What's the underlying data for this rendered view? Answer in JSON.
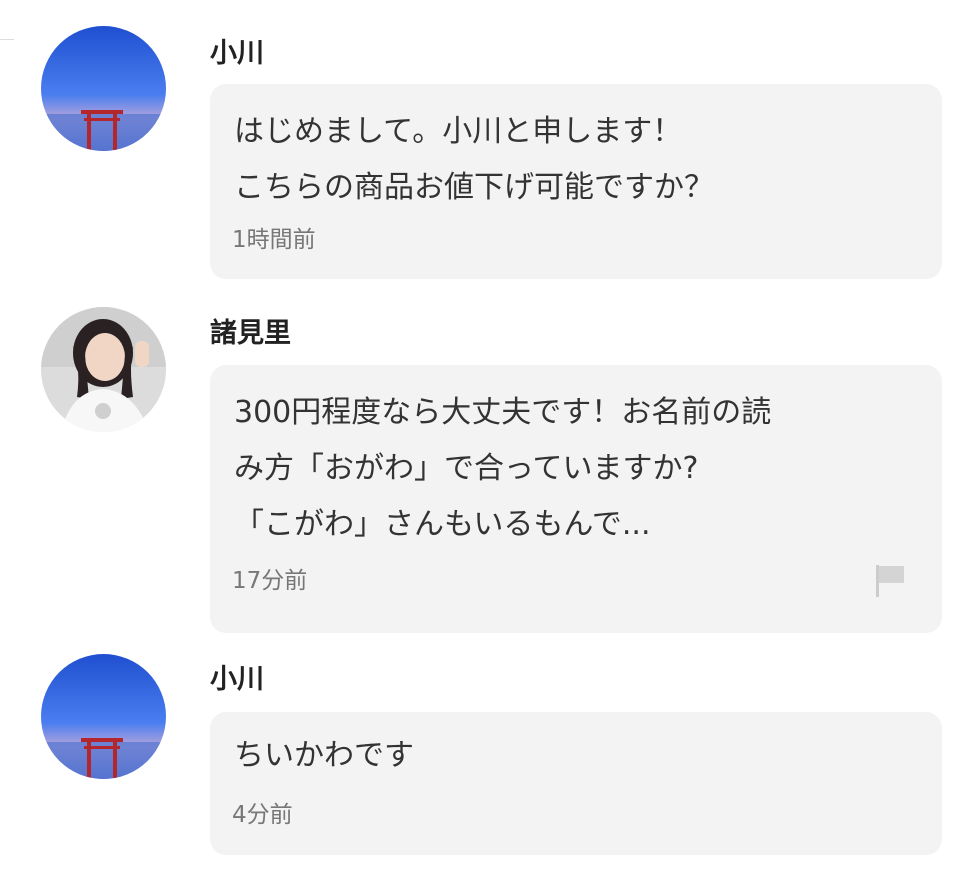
{
  "comments": [
    {
      "user": "小川",
      "text": "はじめまして。小川と申します！\nこちらの商品お値下げ可能ですか？",
      "time": "1時間前",
      "avatar_icon": "torii-sunset-avatar"
    },
    {
      "user": "諸見里",
      "text": "300円程度なら大丈夫です！お名前の読\nみ方「おがわ」で合っていますか?\n「こがわ」さんもいるもんで...",
      "time": "17分前",
      "avatar_icon": "person-photo-avatar",
      "report_icon": "flag-icon"
    },
    {
      "user": "小川",
      "text": "ちいかわです",
      "time": "4分前",
      "avatar_icon": "torii-sunset-avatar"
    }
  ],
  "colors": {
    "bubble_bg": "#f3f3f3",
    "timestamp": "#777777",
    "text": "#333333"
  }
}
